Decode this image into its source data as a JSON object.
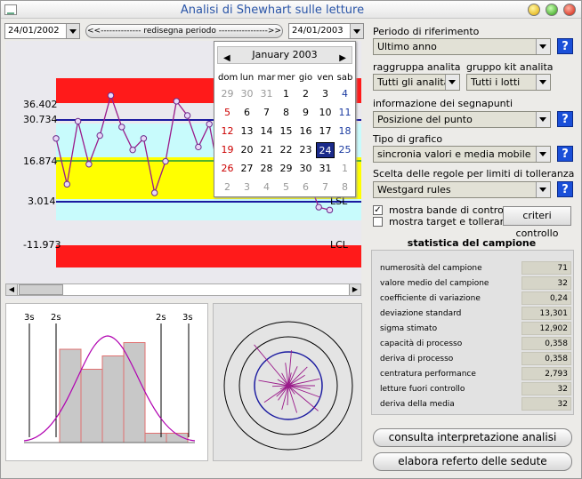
{
  "window": {
    "title": "Analisi di Shewhart sulle letture"
  },
  "toolbar": {
    "date_from": "24/01/2002",
    "redraw_label": "<<--------------   redisegna periodo   ----------------->>",
    "date_to": "24/01/2003"
  },
  "calendar": {
    "month_label": "January 2003",
    "weekdays": [
      "dom",
      "lun",
      "mar",
      "mer",
      "gio",
      "ven",
      "sab"
    ],
    "days": [
      [
        "29",
        "30",
        "31",
        "1",
        "2",
        "3",
        "4"
      ],
      [
        "5",
        "6",
        "7",
        "8",
        "9",
        "10",
        "11"
      ],
      [
        "12",
        "13",
        "14",
        "15",
        "16",
        "17",
        "18"
      ],
      [
        "19",
        "20",
        "21",
        "22",
        "23",
        "24",
        "25"
      ],
      [
        "26",
        "27",
        "28",
        "29",
        "30",
        "31",
        "1"
      ],
      [
        "2",
        "3",
        "4",
        "5",
        "6",
        "7",
        "8"
      ]
    ],
    "selected_day": "24"
  },
  "control_chart": {
    "y_labels": [
      {
        "value": "36.402"
      },
      {
        "value": "30.734"
      },
      {
        "value": "16.874"
      },
      {
        "value": "3.014",
        "tag": "LSL"
      },
      {
        "value": "-11.973",
        "tag": "LCL"
      }
    ],
    "points": [
      25,
      9,
      31,
      16,
      26,
      40,
      29,
      21,
      25,
      6,
      17,
      38,
      33,
      22,
      30,
      10,
      10,
      10,
      10,
      10,
      10,
      10,
      10,
      11,
      1,
      0
    ]
  },
  "histogram": {
    "labels": [
      "3s",
      "2s",
      "2s",
      "3s"
    ],
    "bars": [
      0.7,
      0.55,
      0.65,
      0.75,
      0.07,
      0.07
    ]
  },
  "settings": {
    "period_label": "Periodo di riferimento",
    "period_value": "Ultimo anno",
    "group_label": "raggruppa analita",
    "group_value": "Tutti gli analita",
    "kit_label": "gruppo kit analita",
    "kit_value": "Tutti i lotti",
    "marker_label": "informazione dei segnapunti",
    "marker_value": "Posizione del punto",
    "chart_type_label": "Tipo di grafico",
    "chart_type_value": "sincronia valori e media mobile",
    "rules_label": "Scelta delle regole per limiti di tolleranza",
    "rules_value": "Westgard rules",
    "show_bands_label": "mostra bande di controllo",
    "show_bands_checked": true,
    "show_target_label": "mostra target e tolleranze",
    "show_target_checked": false,
    "criteria_button": "criteri controllo",
    "help": "?"
  },
  "stats": {
    "title": "statistica del campione",
    "rows": [
      {
        "label": "numerosità del campione",
        "value": "71"
      },
      {
        "label": "valore medio del campione",
        "value": "32"
      },
      {
        "label": "coefficiente di variazione",
        "value": "0,24"
      },
      {
        "label": "deviazione standard",
        "value": "13,301"
      },
      {
        "label": "sigma stimato",
        "value": "12,902"
      },
      {
        "label": "capacità di processo",
        "value": "0,358"
      },
      {
        "label": "deriva di processo",
        "value": "0,358"
      },
      {
        "label": "centratura performance",
        "value": "2,793"
      },
      {
        "label": "letture fuori controllo",
        "value": "32"
      },
      {
        "label": "deriva della media",
        "value": "32"
      }
    ]
  },
  "buttons": {
    "interpret": "consulta interpretazione analisi",
    "report": "elabora referto delle sedute"
  },
  "colors": {
    "red_band": "#ff1a1a",
    "cyan_band": "#c8fbfc",
    "yellow_band": "#ffff00",
    "blue_line": "#1a1aa0",
    "series": "#9a1a8a",
    "green_line": "#1a9a3a"
  }
}
